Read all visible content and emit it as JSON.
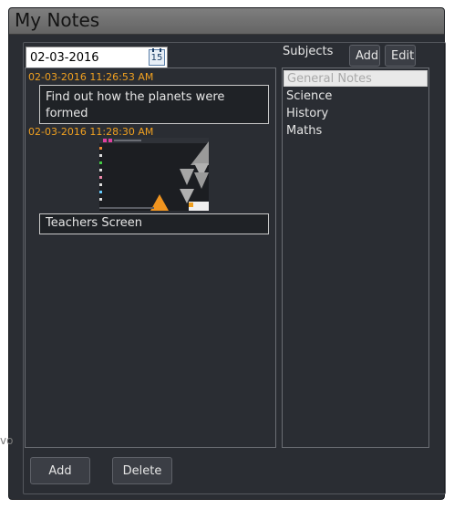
{
  "window": {
    "title": "My Notes"
  },
  "date_picker": {
    "value": "02-03-2016",
    "calendar_label": "15"
  },
  "subjects": {
    "label": "Subjects",
    "add_label": "Add",
    "edit_label": "Edit",
    "items": [
      {
        "label": "General Notes",
        "selected": true
      },
      {
        "label": "Science"
      },
      {
        "label": "History"
      },
      {
        "label": "Maths"
      }
    ]
  },
  "notes": [
    {
      "timestamp": "02-03-2016 11:26:53 AM",
      "text": "Find out how the planets were formed"
    },
    {
      "timestamp": "02-03-2016 11:28:30 AM",
      "text": "Teachers Screen",
      "has_image": true
    }
  ],
  "footer": {
    "add_label": "Add",
    "delete_label": "Delete"
  },
  "edge_fragment": "vo",
  "colors": {
    "timestamp": "#f0a020",
    "background": "#2a2d33",
    "titlebar": "#707070"
  }
}
